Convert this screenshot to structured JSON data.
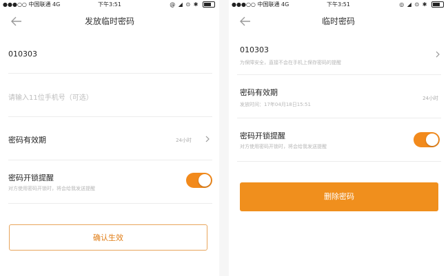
{
  "left": {
    "status": {
      "signal_dots": "●●●○○",
      "carrier": "中国联通",
      "network": "4G",
      "time": "下午3:51",
      "icons": "@ ◢ ⊙ ✱"
    },
    "title": "发放临时密码",
    "password": "010303",
    "phone_placeholder": "请输入11位手机号（可选）",
    "validity_label": "密码有效期",
    "validity_value": "24小时",
    "reminder_label": "密码开锁提醒",
    "reminder_desc": "对方使用密码开锁时，将会给我发送提醒",
    "reminder_on": true,
    "confirm_button": "确认生效"
  },
  "right": {
    "status": {
      "signal_dots": "●●●○○",
      "carrier": "中国联通",
      "network": "4G",
      "time": "下午3:51",
      "icons": "◎ ◢ ⊙ ✱"
    },
    "title": "临时密码",
    "password": "010303",
    "password_note": "为保障安全，直接不会在手机上保存密码的提醒",
    "validity_label": "密码有效期",
    "validity_time": "发放时间：17年04月18日15:51",
    "validity_value": "24小时",
    "reminder_label": "密码开锁提醒",
    "reminder_desc": "对方使用密码开锁时，将会给我发送提醒",
    "reminder_on": true,
    "delete_button": "删除密码"
  },
  "colors": {
    "accent": "#f08f1d",
    "outline": "#e8a45a",
    "text_primary": "#222222",
    "text_secondary": "#b6b6b6"
  }
}
